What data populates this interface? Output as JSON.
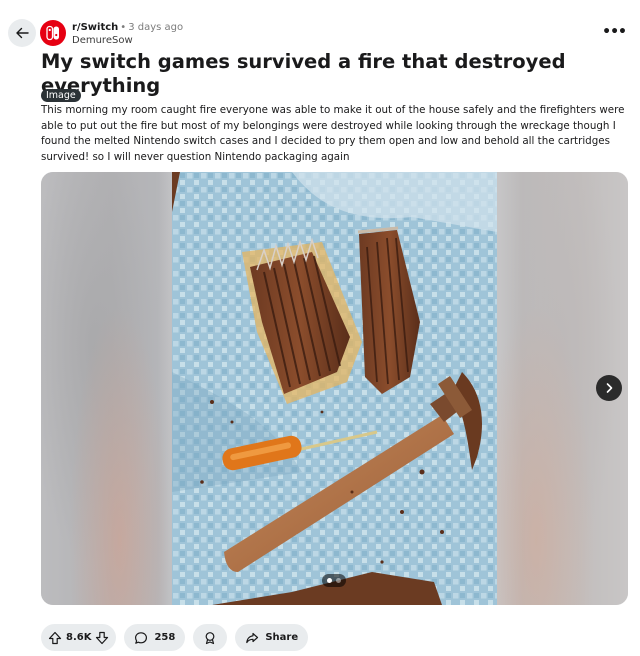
{
  "post": {
    "subreddit": "r/Switch",
    "separator": "•",
    "age": "3 days ago",
    "author": "DemureSow",
    "more_label": "•••",
    "title": "My switch games survived a fire that destroyed everything",
    "flair": "Image",
    "body": "This morning my room caught fire everyone was able to make it out of the house safely and the firefighters were able to put out the fire but most of my belongings were destroyed while looking through the wreckage though I found the melted Nintendo switch cases and I decided to pry them open and low and behold all the cartridges survived! so I will never question Nintendo packaging again"
  },
  "gallery": {
    "current_index": 1,
    "total": 2,
    "next_icon": "chevron-right-icon"
  },
  "actions": {
    "votes": "8.6K",
    "comments": "258",
    "award_icon": "award-icon",
    "share": "Share"
  },
  "colors": {
    "subreddit_avatar": "#e60012",
    "pill_bg": "#e9ecee",
    "flair_bg": "#2b3236"
  }
}
